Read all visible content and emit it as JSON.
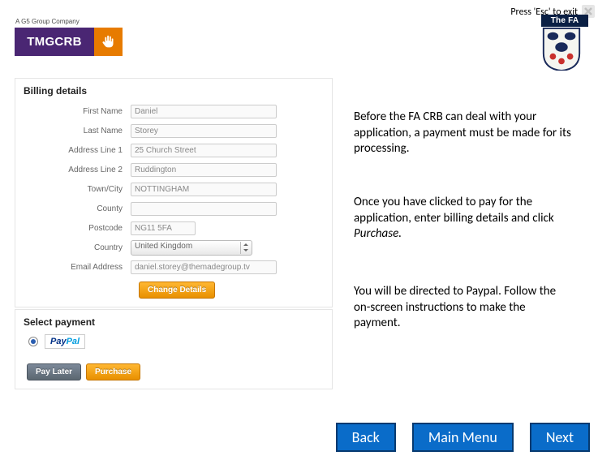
{
  "header": {
    "esc_text": "Press 'Esc' to exit",
    "tagline": "A G5 Group Company",
    "brand": "TMGCRB",
    "fa_text": "The FA"
  },
  "billing": {
    "title": "Billing details",
    "fields": {
      "first_name": {
        "label": "First Name",
        "value": "Daniel"
      },
      "last_name": {
        "label": "Last Name",
        "value": "Storey"
      },
      "address1": {
        "label": "Address Line 1",
        "value": "25 Church Street"
      },
      "address2": {
        "label": "Address Line 2",
        "value": "Ruddington"
      },
      "town": {
        "label": "Town/City",
        "value": "NOTTINGHAM"
      },
      "county": {
        "label": "County",
        "value": ""
      },
      "postcode": {
        "label": "Postcode",
        "value": "NG11 5FA"
      },
      "country": {
        "label": "Country",
        "value": "United Kingdom"
      },
      "email": {
        "label": "Email Address",
        "value": "daniel.storey@themadegroup.tv"
      }
    },
    "change_btn": "Change Details"
  },
  "payment": {
    "title": "Select payment",
    "paypal_a": "Pay",
    "paypal_b": "Pal",
    "pay_later": "Pay Later",
    "purchase": "Purchase"
  },
  "info": {
    "p1": "Before the FA CRB can deal with your application, a payment must be made for its processing.",
    "p2a": "Once you have clicked to pay for the application, enter billing details and click ",
    "p2b": "Purchase.",
    "p3": "You will be directed to Paypal. Follow the on-screen instructions to make the payment."
  },
  "nav": {
    "back": "Back",
    "menu": "Main Menu",
    "next": "Next"
  }
}
